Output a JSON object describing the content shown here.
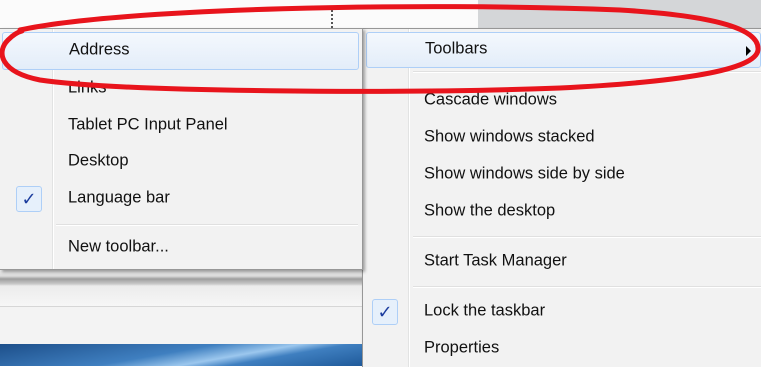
{
  "toolbars_submenu": {
    "items": [
      {
        "label": "Address",
        "checked": false
      },
      {
        "label": "Links",
        "checked": false
      },
      {
        "label": "Tablet PC Input Panel",
        "checked": false
      },
      {
        "label": "Desktop",
        "checked": false
      },
      {
        "label": "Language bar",
        "checked": true
      }
    ],
    "new_toolbar": "New toolbar..."
  },
  "taskbar_menu": {
    "toolbars": "Toolbars",
    "cascade": "Cascade windows",
    "stacked": "Show windows stacked",
    "side_by_side": "Show windows side by side",
    "show_desktop": "Show the desktop",
    "task_manager": "Start Task Manager",
    "lock_taskbar": "Lock the taskbar",
    "lock_taskbar_checked": true,
    "properties": "Properties"
  },
  "check_mark": "✓",
  "colors": {
    "annotation": "#e8141c",
    "check": "#1c3d9e",
    "highlight_border": "#aecff7"
  }
}
